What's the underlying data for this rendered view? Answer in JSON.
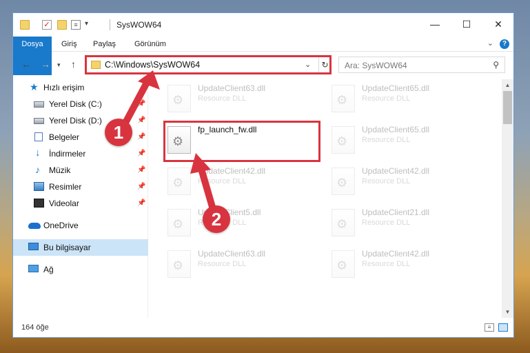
{
  "window": {
    "title": "SysWOW64",
    "controls": {
      "minimize": "—",
      "maximize": "☐",
      "close": "✕"
    }
  },
  "ribbon": {
    "tabs": [
      "Dosya",
      "Giriş",
      "Paylaş",
      "Görünüm"
    ],
    "help": "?"
  },
  "address": {
    "path": "C:\\Windows\\SysWOW64",
    "search_placeholder": "Ara: SysWOW64"
  },
  "sidebar": {
    "items": [
      {
        "label": "Hızlı erişim",
        "icon": "star-icon"
      },
      {
        "label": "Yerel Disk (C:)",
        "icon": "drive-icon"
      },
      {
        "label": "Yerel Disk (D:)",
        "icon": "drive-icon"
      },
      {
        "label": "Belgeler",
        "icon": "documents-icon"
      },
      {
        "label": "İndirmeler",
        "icon": "download-icon"
      },
      {
        "label": "Müzik",
        "icon": "music-icon"
      },
      {
        "label": "Resimler",
        "icon": "pictures-icon"
      },
      {
        "label": "Videolar",
        "icon": "videos-icon"
      },
      {
        "label": "OneDrive",
        "icon": "cloud-icon"
      },
      {
        "label": "Bu bilgisayar",
        "icon": "computer-icon"
      },
      {
        "label": "Ağ",
        "icon": "network-icon"
      }
    ]
  },
  "files": {
    "left": [
      {
        "name": "UpdateClient63.dll",
        "type": "Resource DLL"
      },
      {
        "name": "fp_launch_fw.dll",
        "type": ""
      },
      {
        "name": "UpdateClient42.dll",
        "type": "Resource DLL"
      },
      {
        "name": "UpdateClient5.dll",
        "type": "Resource DLL"
      },
      {
        "name": "UpdateClient63.dll",
        "type": "Resource DLL"
      }
    ],
    "right": [
      {
        "name": "UpdateClient65.dll",
        "type": "Resource DLL"
      },
      {
        "name": "UpdateClient65.dll",
        "type": "Resource DLL"
      },
      {
        "name": "UpdateClient42.dll",
        "type": "Resource DLL"
      },
      {
        "name": "UpdateClient21.dll",
        "type": "Resource DLL"
      },
      {
        "name": "UpdateClient42.dll",
        "type": "Resource DLL"
      }
    ]
  },
  "status": {
    "count": "164 öğe"
  },
  "annotations": {
    "badge1": "1",
    "badge2": "2",
    "color": "#d8343f"
  }
}
